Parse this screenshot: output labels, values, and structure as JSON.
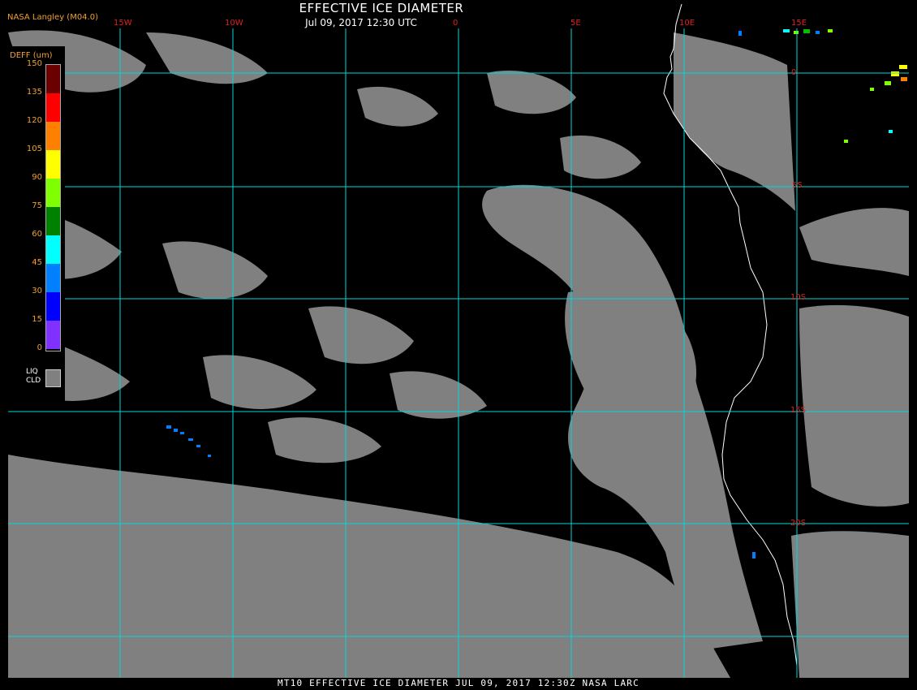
{
  "header": {
    "title": "EFFECTIVE ICE DIAMETER",
    "subtitle": "Jul 09, 2017 12:30 UTC",
    "producer": "NASA Langley (M04.0)"
  },
  "legend": {
    "title": "DEFF (um)",
    "ticks": [
      "150",
      "135",
      "120",
      "105",
      "90",
      "75",
      "60",
      "45",
      "30",
      "15",
      "0"
    ],
    "colors": [
      "#6b0000",
      "#ff0000",
      "#ff8000",
      "#ffff00",
      "#80ff00",
      "#008000",
      "#00ffff",
      "#0080ff",
      "#0000ff",
      "#8030ff"
    ],
    "liquid_label_1": "LIQ",
    "liquid_label_2": "CLD",
    "liquid_color": "#808080"
  },
  "map": {
    "lon_labels": [
      "15W",
      "10W",
      "0",
      "5E",
      "10E",
      "15E"
    ],
    "lat_labels": [
      "0",
      "5S",
      "10S",
      "15S",
      "20S"
    ],
    "grid_color": "#00d8d8",
    "label_color": "#e02020",
    "cloud_color": "#808080",
    "coast_color": "#ffffff"
  },
  "footer": {
    "text": "MT10  EFFECTIVE ICE DIAMETER  JUL 09, 2017 12:30Z  NASA LARC"
  }
}
